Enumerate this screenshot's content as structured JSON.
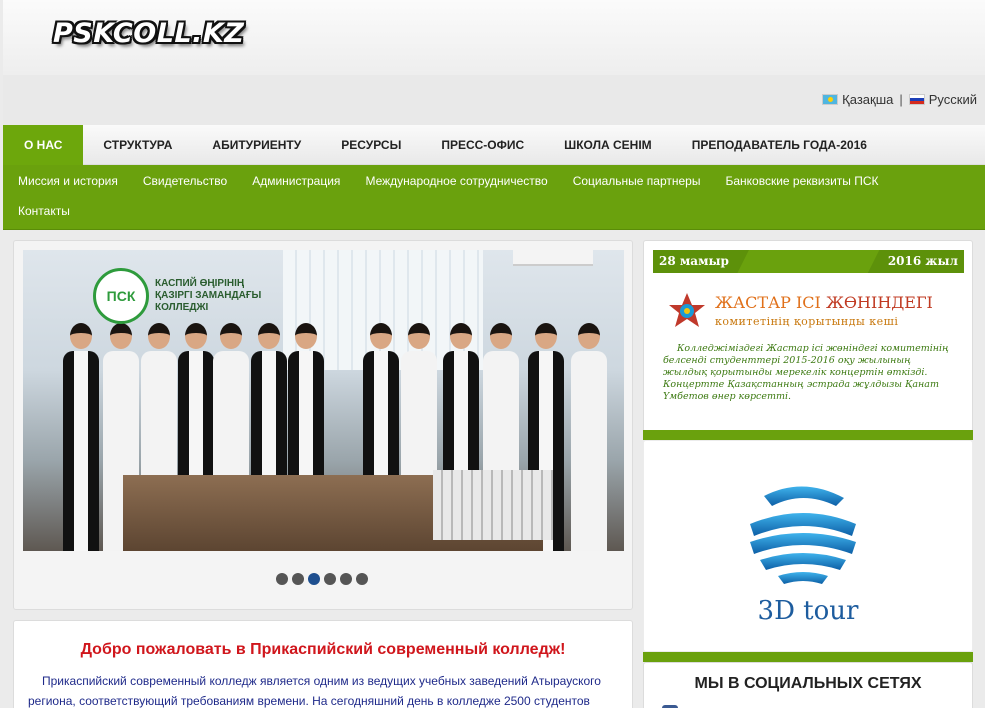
{
  "header": {
    "logo_text": "PSKCOLL.KZ"
  },
  "languages": [
    {
      "label": "Қазақша",
      "flag": "flag-kz-icon"
    },
    {
      "label": "Русский",
      "flag": "flag-ru-icon"
    }
  ],
  "lang_separator": "|",
  "main_nav": [
    {
      "label": "О НАС",
      "active": true
    },
    {
      "label": "СТРУКТУРА"
    },
    {
      "label": "АБИТУРИЕНТУ"
    },
    {
      "label": "РЕСУРСЫ"
    },
    {
      "label": "ПРЕСС-ОФИС"
    },
    {
      "label": "ШКОЛА СЕНІМ"
    },
    {
      "label": "ПРЕПОДАВАТЕЛЬ ГОДА-2016"
    }
  ],
  "sub_nav": [
    "Миссия и история",
    "Свидетельство",
    "Администрация",
    "Международное сотрудничество",
    "Социальные партнеры",
    "Банковские реквизиты ПСК",
    "Контакты"
  ],
  "slider": {
    "logo_badge": "ПСК",
    "logo_text": "КАСПИЙ ӨҢІРІНІҢ ҚАЗІРГІ ЗАМАНДАҒЫ КОЛЛЕДЖІ",
    "dot_count": 6,
    "active_index": 2
  },
  "welcome": {
    "title": "Добро пожаловать в Прикаспийский современный колледж!",
    "text": "Прикаспийский современный колледж является одним из ведущих учебных заведений Атырауского региона, соответствующий требованиям времени. На сегодняшний день в колледже 2500 студентов"
  },
  "banner": {
    "date_left": "28 мамыр",
    "date_right": "2016 жыл",
    "title_part1": "ЖАСТАР ІСІ ",
    "title_part2": "ЖӨНІНДЕГІ",
    "subtitle": "комитетінің қорытынды кеші",
    "body": "Колледжіміздегі Жастар ісі жөніндегі комитетінің белсенді студенттері 2015-2016 оқу жылының жылдық қорытынды мерекелік концертін өткізді. Концертте Қазақстанның эстрада жұлдызы Қанат Үмбетов өнер көрсетті."
  },
  "tour": {
    "label": "3D  tour"
  },
  "social": {
    "title": "МЫ В СОЦИАЛЬНЫХ СЕТЯХ"
  },
  "colors": {
    "green": "#6aa10d",
    "red_title": "#d0161c",
    "blue_text": "#1f2a8a"
  }
}
